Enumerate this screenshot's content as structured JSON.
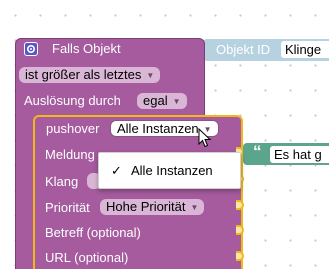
{
  "if_block": {
    "title": "Falls Objekt",
    "condition_dropdown": "ist größer als letztes",
    "trigger_label": "Auslösung durch",
    "trigger_dropdown": "egal"
  },
  "object_id_block": {
    "label": "Objekt ID",
    "value": "Klinge"
  },
  "pushover_block": {
    "title": "pushover",
    "instance_dropdown": "Alle Instanzen",
    "fields": {
      "message": "Meldung",
      "sound": "Klang",
      "priority": "Priorität",
      "priority_dropdown": "Hohe Priorität",
      "subject": "Betreff (optional)",
      "url": "URL (optional)"
    }
  },
  "text_block": {
    "quote": "“",
    "value": "Es hat g"
  },
  "dropdown_menu": {
    "items": [
      {
        "label": "Alle Instanzen",
        "check": "✓"
      }
    ]
  },
  "colors": {
    "event_block": "#a55b9e",
    "pushover_block": "#a55b9e",
    "pushover_border": "#f2b81a",
    "object_id_block": "#b6d2e0",
    "text_block": "#5ba58c"
  }
}
